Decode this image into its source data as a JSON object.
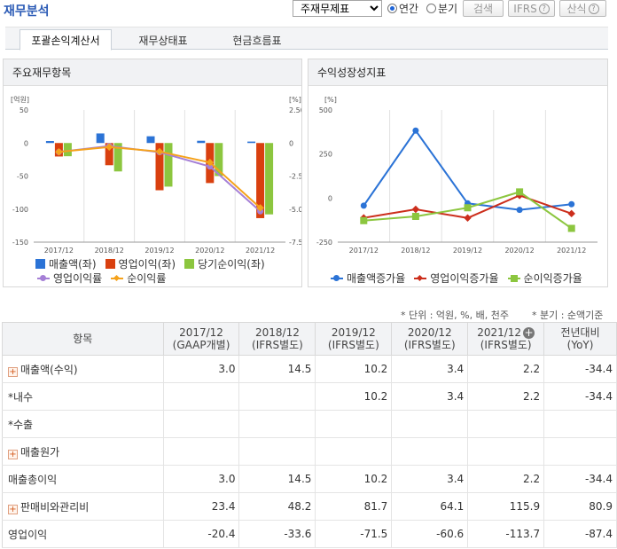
{
  "page_title": "재무분석",
  "controls": {
    "report_select": "주재무제표",
    "radio_annual": "연간",
    "radio_quarter": "분기",
    "search_button": "검색",
    "ifrs_button": "IFRS",
    "formula_button": "산식"
  },
  "tabs": [
    "포괄손익계산서",
    "재무상태표",
    "현금흐름표"
  ],
  "left_panel": {
    "title": "주요재무항목",
    "left_unit": "[억원]",
    "right_unit": "[%]",
    "legend": [
      "매출액(좌)",
      "영업이익(좌)",
      "당기순이익(좌)",
      "영업이익률",
      "순이익률"
    ]
  },
  "right_panel": {
    "title": "수익성장성지표",
    "unit": "[%]",
    "legend": [
      "매출액증가율",
      "영업이익증가율",
      "순이익증가율"
    ]
  },
  "notes": {
    "unit_note": "* 단위 : 억원, %, 배, 천주",
    "quarter_note": "* 분기 : 순액기준"
  },
  "table": {
    "header_item": "항목",
    "columns": [
      {
        "period": "2017/12",
        "basis": "(GAAP개별)"
      },
      {
        "period": "2018/12",
        "basis": "(IFRS별도)"
      },
      {
        "period": "2019/12",
        "basis": "(IFRS별도)"
      },
      {
        "period": "2020/12",
        "basis": "(IFRS별도)"
      },
      {
        "period": "2021/12",
        "basis": "(IFRS별도)"
      }
    ],
    "yoy_header_1": "전년대비",
    "yoy_header_2": "(YoY)",
    "rows": [
      {
        "name": "매출액(수익)",
        "expand": true,
        "values": [
          "3.0",
          "14.5",
          "10.2",
          "3.4",
          "2.2",
          "-34.4"
        ]
      },
      {
        "name": "*내수",
        "expand": false,
        "values": [
          "",
          "",
          "10.2",
          "3.4",
          "2.2",
          "-34.4"
        ]
      },
      {
        "name": "*수출",
        "expand": false,
        "values": [
          "",
          "",
          "",
          "",
          "",
          ""
        ]
      },
      {
        "name": "매출원가",
        "expand": true,
        "values": [
          "",
          "",
          "",
          "",
          "",
          ""
        ]
      },
      {
        "name": "매출총이익",
        "expand": false,
        "values": [
          "3.0",
          "14.5",
          "10.2",
          "3.4",
          "2.2",
          "-34.4"
        ]
      },
      {
        "name": "판매비와관리비",
        "expand": true,
        "values": [
          "23.4",
          "48.2",
          "81.7",
          "64.1",
          "115.9",
          "80.9"
        ]
      },
      {
        "name": "영업이익",
        "expand": false,
        "values": [
          "-20.4",
          "-33.6",
          "-71.5",
          "-60.6",
          "-113.7",
          "-87.4"
        ]
      }
    ]
  },
  "colors": {
    "sales": "#2b73d6",
    "op_income": "#d9400f",
    "net_income": "#8cc63f",
    "op_margin": "#a57fd6",
    "net_margin": "#f5a21b",
    "sales_growth": "#2b73d6",
    "op_growth": "#cc2e1c",
    "net_growth": "#8cc63f"
  },
  "chart_data": [
    {
      "type": "bar",
      "title": "주요재무항목",
      "categories": [
        "2017/12",
        "2018/12",
        "2019/12",
        "2020/12",
        "2021/12"
      ],
      "series": [
        {
          "name": "매출액(좌)",
          "axis": "left",
          "values": [
            3.0,
            14.5,
            10.2,
            3.4,
            2.2
          ]
        },
        {
          "name": "영업이익(좌)",
          "axis": "left",
          "values": [
            -20.4,
            -33.6,
            -71.5,
            -60.6,
            -113.7
          ]
        },
        {
          "name": "당기순이익(좌)",
          "axis": "left",
          "values": [
            -20,
            -43,
            -66,
            -50,
            -108
          ]
        },
        {
          "name": "영업이익률",
          "axis": "right",
          "type": "line",
          "values": [
            -0.68,
            -0.23,
            -0.7,
            -1.78,
            -5.17
          ]
        },
        {
          "name": "순이익률",
          "axis": "right",
          "type": "line",
          "values": [
            -0.67,
            -0.3,
            -0.65,
            -1.47,
            -4.91
          ]
        }
      ],
      "left_ylim": [
        -150,
        50
      ],
      "left_yticks": [
        50,
        0,
        -50,
        -100,
        -150
      ],
      "right_ylim": [
        -7.5,
        2.5
      ],
      "right_yticks": [
        "2.50",
        "0",
        "-2.5",
        "-5.0",
        "-7.5"
      ],
      "left_unit": "[억원]",
      "right_unit": "[%]",
      "grid": "vertical",
      "legend": "bottom"
    },
    {
      "type": "line",
      "title": "수익성장성지표",
      "categories": [
        "2017/12",
        "2018/12",
        "2019/12",
        "2020/12",
        "2021/12"
      ],
      "series": [
        {
          "name": "매출액증가율",
          "values": [
            -43,
            383,
            -30,
            -67,
            -35
          ]
        },
        {
          "name": "영업이익증가율",
          "values": [
            -112,
            -64,
            -113,
            15,
            -88
          ]
        },
        {
          "name": "순이익증가율",
          "values": [
            -128,
            -104,
            -55,
            35,
            -172
          ]
        }
      ],
      "ylim": [
        -250,
        500
      ],
      "yticks": [
        500,
        250,
        0,
        -250
      ],
      "unit": "[%]",
      "grid": "vertical",
      "legend": "bottom"
    }
  ]
}
